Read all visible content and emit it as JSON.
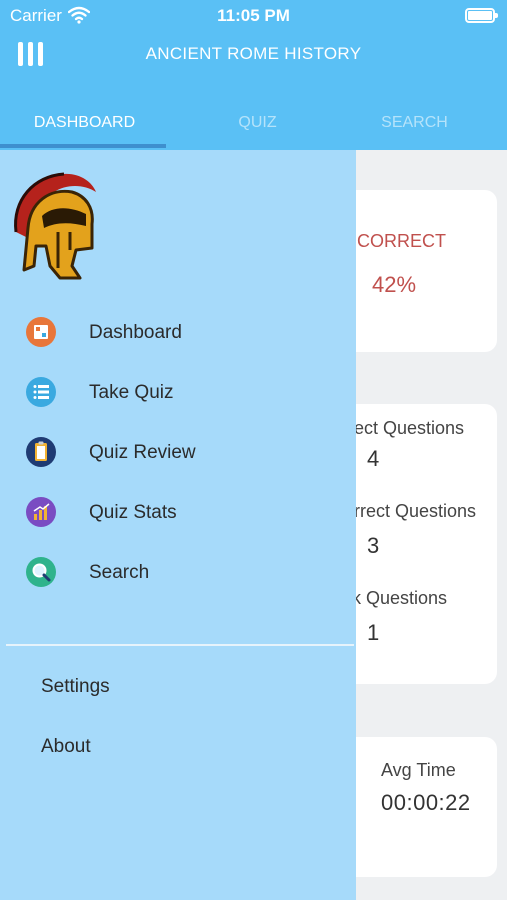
{
  "status_bar": {
    "carrier": "Carrier",
    "time": "11:05 PM"
  },
  "header": {
    "title": "ANCIENT ROME HISTORY"
  },
  "tabs": [
    {
      "label": "DASHBOARD",
      "active": true
    },
    {
      "label": "QUIZ",
      "active": false
    },
    {
      "label": "SEARCH",
      "active": false
    }
  ],
  "background": {
    "incorrect_label": "ICORRECT",
    "incorrect_value": "42%",
    "stats": [
      {
        "label": "ect Questions",
        "value": "4"
      },
      {
        "label": "rrect Questions",
        "value": "3"
      },
      {
        "label": "k Questions",
        "value": "1"
      }
    ],
    "avg_time_label": "Avg Time",
    "avg_time_value": "00:00:22"
  },
  "drawer": {
    "items": [
      {
        "label": "Dashboard",
        "icon": "dashboard-icon",
        "color": "#e8763a"
      },
      {
        "label": "Take Quiz",
        "icon": "quiz-list-icon",
        "color": "#3aa9e0"
      },
      {
        "label": "Quiz Review",
        "icon": "clipboard-icon",
        "color": "#1f3b73"
      },
      {
        "label": "Quiz Stats",
        "icon": "stats-chart-icon",
        "color": "#7a4cc2"
      },
      {
        "label": "Search",
        "icon": "magnifier-icon",
        "color": "#2fb38c"
      }
    ],
    "secondary": [
      {
        "label": "Settings"
      },
      {
        "label": "About"
      }
    ]
  },
  "colors": {
    "header": "#5ac0f5",
    "drawer": "#a6dafa",
    "incorrect": "#c0504d"
  }
}
